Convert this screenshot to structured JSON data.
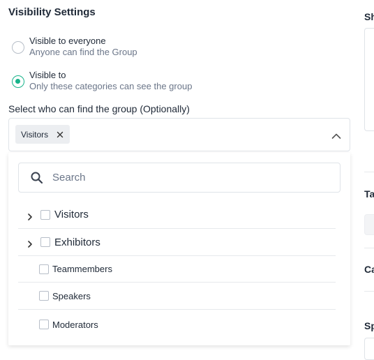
{
  "visibility": {
    "title": "Visibility Settings",
    "options": [
      {
        "label": "Visible to everyone",
        "sub": "Anyone can find the Group",
        "checked": false
      },
      {
        "label": "Visible to",
        "sub": "Only these categories can see the group",
        "checked": true
      }
    ]
  },
  "select": {
    "label": "Select who can find the group (Optionally)",
    "chips": [
      {
        "label": "Visitors"
      }
    ]
  },
  "dropdown": {
    "search_placeholder": "Search",
    "items": [
      {
        "label": "Visitors",
        "expandable": true
      },
      {
        "label": "Exhibitors",
        "expandable": true
      },
      {
        "label": "Teammembers",
        "expandable": false
      },
      {
        "label": "Speakers",
        "expandable": false
      },
      {
        "label": "Moderators",
        "expandable": false
      }
    ]
  },
  "right_panel": {
    "labels": [
      "Sh",
      "Ta",
      "Ca",
      "Sp"
    ]
  },
  "colors": {
    "accent": "#17b38a",
    "muted_text": "#6b7689",
    "border": "#dfe3e8"
  }
}
